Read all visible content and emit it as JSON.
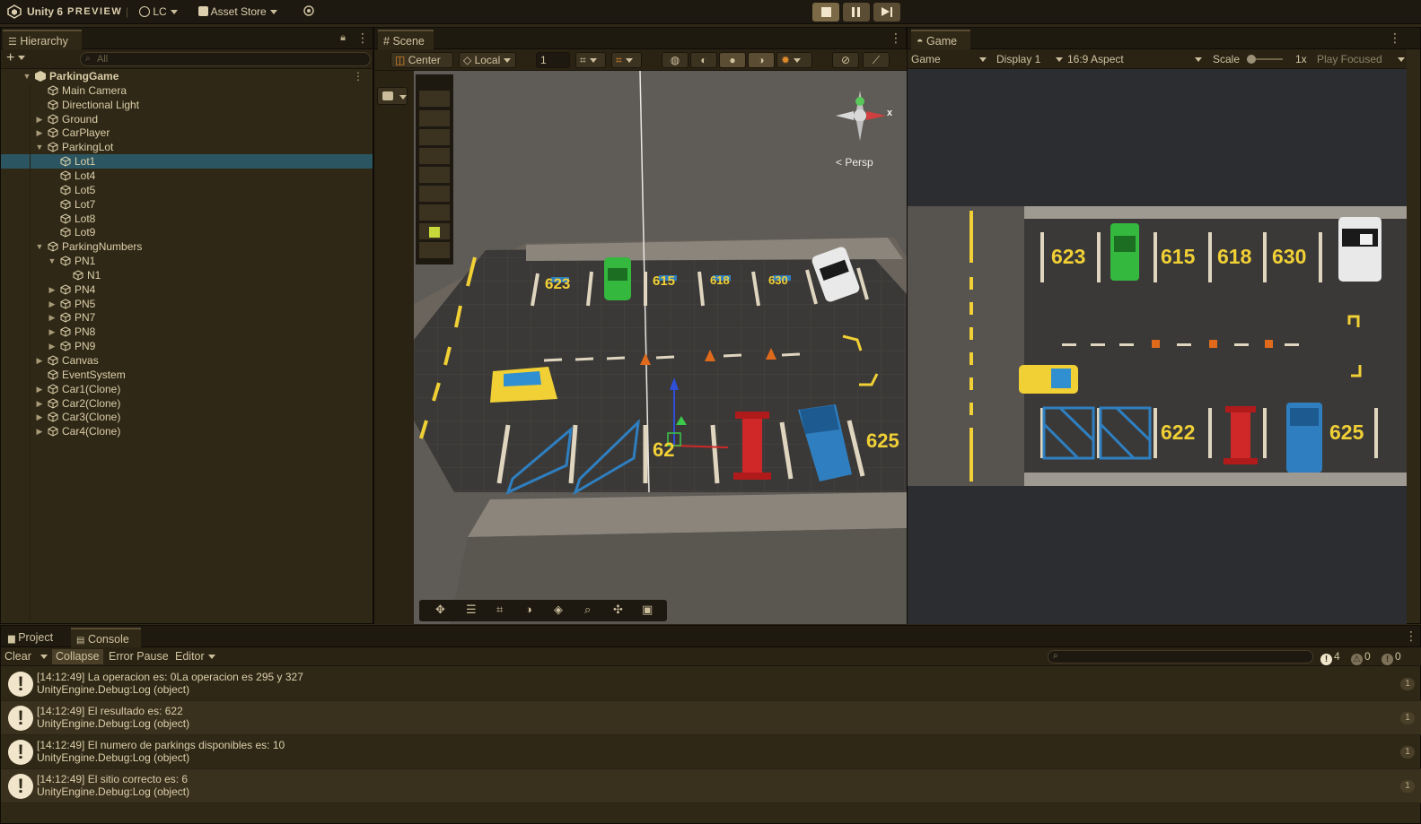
{
  "topbar": {
    "app_title": "Unity 6",
    "app_badge": "PREVIEW",
    "account": "LC",
    "asset_store": "Asset Store"
  },
  "hierarchy": {
    "tab": "Hierarchy",
    "search_placeholder": "All",
    "rows": [
      {
        "label": "ParkingGame",
        "depth": 0,
        "arrow": "down",
        "scene": true
      },
      {
        "label": "Main Camera",
        "depth": 1,
        "arrow": ""
      },
      {
        "label": "Directional Light",
        "depth": 1,
        "arrow": ""
      },
      {
        "label": "Ground",
        "depth": 1,
        "arrow": "right"
      },
      {
        "label": "CarPlayer",
        "depth": 1,
        "arrow": "right"
      },
      {
        "label": "ParkingLot",
        "depth": 1,
        "arrow": "down"
      },
      {
        "label": "Lot1",
        "depth": 2,
        "arrow": "",
        "selected": true
      },
      {
        "label": "Lot4",
        "depth": 2,
        "arrow": ""
      },
      {
        "label": "Lot5",
        "depth": 2,
        "arrow": ""
      },
      {
        "label": "Lot7",
        "depth": 2,
        "arrow": ""
      },
      {
        "label": "Lot8",
        "depth": 2,
        "arrow": ""
      },
      {
        "label": "Lot9",
        "depth": 2,
        "arrow": ""
      },
      {
        "label": "ParkingNumbers",
        "depth": 1,
        "arrow": "down"
      },
      {
        "label": "PN1",
        "depth": 2,
        "arrow": "down"
      },
      {
        "label": "N1",
        "depth": 3,
        "arrow": ""
      },
      {
        "label": "PN4",
        "depth": 2,
        "arrow": "right"
      },
      {
        "label": "PN5",
        "depth": 2,
        "arrow": "right"
      },
      {
        "label": "PN7",
        "depth": 2,
        "arrow": "right"
      },
      {
        "label": "PN8",
        "depth": 2,
        "arrow": "right"
      },
      {
        "label": "PN9",
        "depth": 2,
        "arrow": "right"
      },
      {
        "label": "Canvas",
        "depth": 1,
        "arrow": "right"
      },
      {
        "label": "EventSystem",
        "depth": 1,
        "arrow": ""
      },
      {
        "label": "Car1(Clone)",
        "depth": 1,
        "arrow": "right"
      },
      {
        "label": "Car2(Clone)",
        "depth": 1,
        "arrow": "right"
      },
      {
        "label": "Car3(Clone)",
        "depth": 1,
        "arrow": "right"
      },
      {
        "label": "Car4(Clone)",
        "depth": 1,
        "arrow": "right"
      }
    ]
  },
  "scene": {
    "tab": "Scene",
    "pivot": "Center",
    "space": "Local",
    "grid_value": "1",
    "persp_label": "Persp",
    "gizmo_axis": "x",
    "world_numbers": [
      "623",
      "615",
      "618",
      "630",
      "62",
      "625"
    ]
  },
  "game": {
    "tab": "Game",
    "mode": "Game",
    "display": "Display 1",
    "aspect": "16:9 Aspect",
    "scale_label": "Scale",
    "scale_value": "1x",
    "play_focused": "Play Focused",
    "top_numbers": [
      "623",
      "615",
      "618",
      "630"
    ],
    "bottom_numbers": [
      "622",
      "625"
    ]
  },
  "console": {
    "tabs": [
      "Project",
      "Console"
    ],
    "clear": "Clear",
    "collapse": "Collapse",
    "error_pause": "Error Pause",
    "editor": "Editor",
    "counts": {
      "info": "4",
      "warning": "0",
      "error": "0"
    },
    "logs": [
      {
        "message": "[14:12:49] La operacion es: 0La operacion es 295 y 327",
        "source": "UnityEngine.Debug:Log (object)",
        "count": "1"
      },
      {
        "message": "[14:12:49] El resultado es: 622",
        "source": "UnityEngine.Debug:Log (object)",
        "count": "1"
      },
      {
        "message": "[14:12:49] El numero de parkings disponibles es: 10",
        "source": "UnityEngine.Debug:Log (object)",
        "count": "1"
      },
      {
        "message": "[14:12:49] El sitio correcto es: 6",
        "source": "UnityEngine.Debug:Log (object)",
        "count": "1"
      }
    ]
  }
}
